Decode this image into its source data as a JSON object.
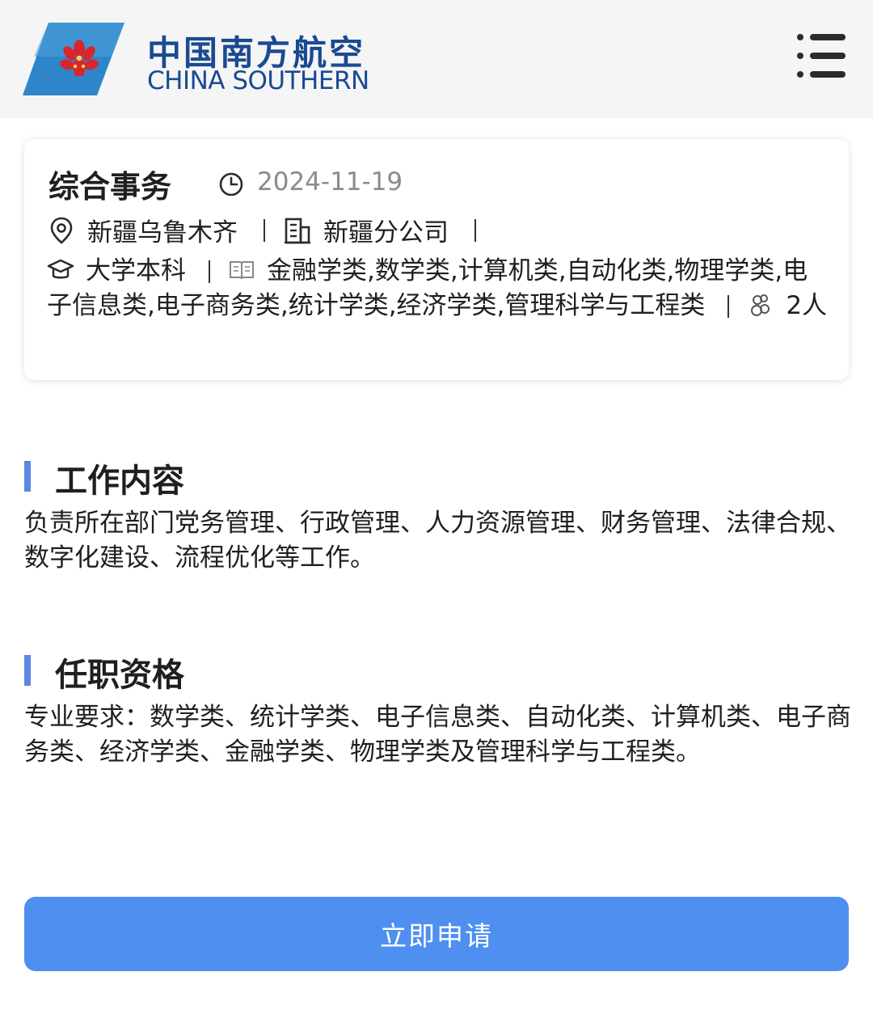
{
  "header": {
    "brand_cn": "中国南方航空",
    "brand_en": "CHINA SOUTHERN",
    "brand_color": "#1a4a92",
    "menu_icon": "hamburger-menu-icon"
  },
  "job": {
    "title": "综合事务",
    "date": "2024-11-19",
    "location": "新疆乌鲁木齐",
    "company": "新疆分公司",
    "education": "大学本科",
    "majors": "金融学类,数学类,计算机类,自动化类,物理学类,电子信息类,电子商务类,统计学类,经济学类,管理科学与工程类",
    "headcount": "2人",
    "icons": {
      "date": "clock-icon",
      "location": "location-pin-icon",
      "company": "building-icon",
      "education": "graduation-cap-icon",
      "majors": "book-icon",
      "headcount": "people-icon"
    }
  },
  "sections": {
    "work_title": "工作内容",
    "work_body": "负责所在部门党务管理、行政管理、人力资源管理、财务管理、法律合规、数字化建设、流程优化等工作。",
    "qual_title": "任职资格",
    "qual_body": "专业要求：数学类、统计学类、电子信息类、自动化类、计算机类、电子商务类、经济学类、金融学类、物理学类及管理科学与工程类。",
    "accent_color": "#5b86e5"
  },
  "apply": {
    "label": "立即申请",
    "color": "#4f8ff0"
  }
}
